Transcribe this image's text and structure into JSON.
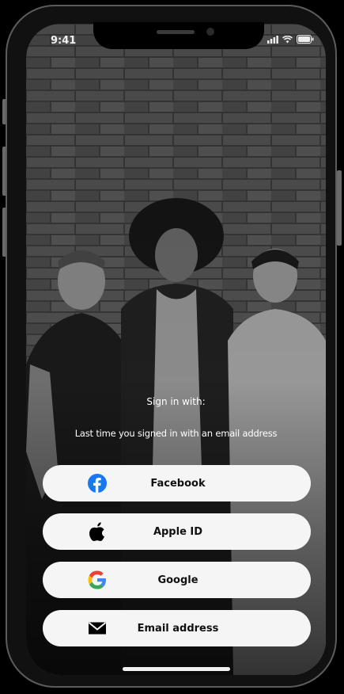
{
  "status_bar": {
    "time": "9:41"
  },
  "sign_in": {
    "title": "Sign in with:",
    "last_time_notice": "Last time you signed in with an email address"
  },
  "auth_options": {
    "facebook": "Facebook",
    "apple": "Apple ID",
    "google": "Google",
    "email": "Email address"
  },
  "colors": {
    "button_bg": "#f5f5f5",
    "facebook_blue": "#1877f2",
    "google_blue": "#4285f4",
    "google_red": "#ea4335",
    "google_yellow": "#fbbc05",
    "google_green": "#34a853"
  }
}
